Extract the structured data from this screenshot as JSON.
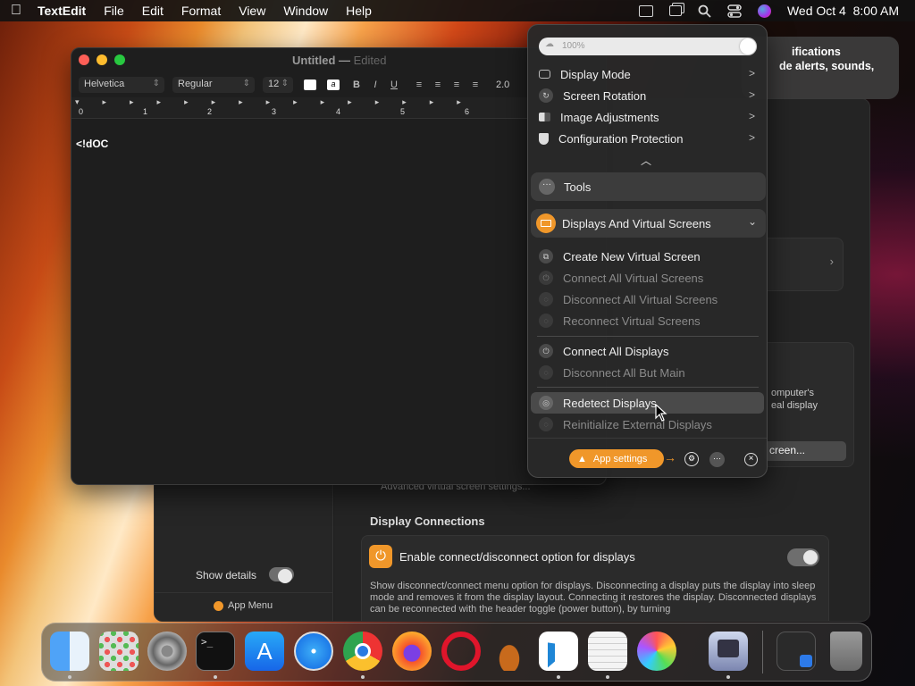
{
  "menubar": {
    "apple": "",
    "app_name": "TextEdit",
    "items": [
      "File",
      "Edit",
      "Format",
      "View",
      "Window",
      "Help"
    ],
    "clock": "Wed Oct 4  8:00 AM"
  },
  "textedit": {
    "title": "Untitled",
    "title_sep": "—",
    "edited": "Edited",
    "font_family": "Helvetica",
    "font_style": "Regular",
    "font_size": "12",
    "bold": "B",
    "italic": "I",
    "underline": "U",
    "spacing": "2.0",
    "ruler": [
      "0",
      "1",
      "2",
      "3",
      "4",
      "5",
      "6"
    ],
    "content": "<!dOC"
  },
  "settings_bg": {
    "show_details": "Show details",
    "app_menu": "App Menu",
    "partial_text_1": "omputer's",
    "partial_text_2": "eal display",
    "partial_button": "creen...",
    "advanced_link": "Advanced virtual screen settings...",
    "section_title": "Display Connections",
    "option_title": "Enable connect/disconnect option for displays",
    "option_desc": "Show disconnect/connect menu option for displays. Disconnecting a display puts the display into sleep mode and removes it from the display layout. Connecting it restores the display. Disconnected displays can be reconnected with the header toggle (power button), by turning"
  },
  "notification": {
    "line1": "ifications",
    "line2": "de alerts, sounds,"
  },
  "panel": {
    "slider_value": "100%",
    "top_items": [
      "Display Mode",
      "Screen Rotation",
      "Image Adjustments",
      "Configuration Protection"
    ],
    "tools": "Tools",
    "section": "Displays And Virtual Screens",
    "virtual_items": [
      {
        "label": "Create New Virtual Screen",
        "enabled": true
      },
      {
        "label": "Connect All Virtual Screens",
        "enabled": false
      },
      {
        "label": "Disconnect All Virtual Screens",
        "enabled": false
      },
      {
        "label": "Reconnect Virtual Screens",
        "enabled": false
      }
    ],
    "display_items": [
      {
        "label": "Connect All Displays",
        "enabled": true
      },
      {
        "label": "Disconnect All But Main",
        "enabled": false
      }
    ],
    "redetect": "Redetect Displays",
    "reinit": "Reinitialize External Displays",
    "app_settings": "App settings"
  },
  "dock": {
    "apps": [
      "finder-icon",
      "launchpad-icon",
      "system-settings-icon",
      "terminal-icon",
      "app-store-icon",
      "safari-icon",
      "chrome-icon",
      "firefox-icon",
      "opera-icon",
      "garageband-icon",
      "vscode-icon",
      "textedit-icon",
      "color-ui-icon",
      "betterdisplay-icon",
      "downloads-stack-icon",
      "trash-icon"
    ]
  },
  "colors": {
    "accent": "#f0972a",
    "close_red": "#fe5f57",
    "minimize_yellow": "#febc2e",
    "zoom_green": "#28c840"
  }
}
